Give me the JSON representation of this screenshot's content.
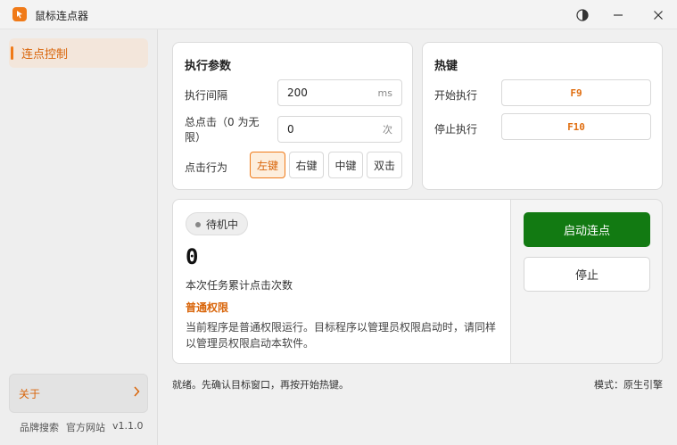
{
  "window": {
    "title": "鼠标连点器"
  },
  "sidebar": {
    "items": [
      {
        "label": "连点控制"
      }
    ],
    "about_label": "关于",
    "footer": {
      "brand_search": "品牌搜索",
      "website": "官方网站",
      "version": "v1.1.0"
    }
  },
  "params": {
    "title": "执行参数",
    "interval": {
      "label": "执行间隔",
      "value": "200",
      "unit": "ms"
    },
    "total": {
      "label": "总点击（0 为无限）",
      "value": "0",
      "unit": "次"
    },
    "behavior": {
      "label": "点击行为",
      "options": [
        "左键",
        "右键",
        "中键",
        "双击"
      ],
      "selected": "左键"
    }
  },
  "hotkeys": {
    "title": "热键",
    "start": {
      "label": "开始执行",
      "key": "F9"
    },
    "stop": {
      "label": "停止执行",
      "key": "F10"
    }
  },
  "status": {
    "badge": "待机中",
    "count": "0",
    "count_label": "本次任务累计点击次数",
    "perm_title": "普通权限",
    "perm_desc": "当前程序是普通权限运行。目标程序以管理员权限启动时，请同样以管理员权限启动本软件。"
  },
  "actions": {
    "start_label": "启动连点",
    "stop_label": "停止"
  },
  "statusbar": {
    "message": "就绪。先确认目标窗口，再按开始热键。",
    "mode": "模式：原生引擎"
  },
  "colors": {
    "accent": "#f07a18",
    "start": "#127a12"
  }
}
